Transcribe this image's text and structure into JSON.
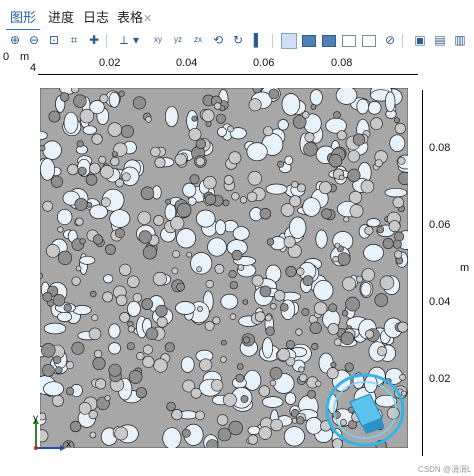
{
  "tabs": [
    {
      "label": "图形",
      "active": true
    },
    {
      "label": "进度",
      "active": false
    },
    {
      "label": "日志",
      "active": false
    },
    {
      "label": "表格",
      "active": false
    }
  ],
  "toolbar": {
    "icons": [
      "zoom-in-icon",
      "zoom-out-icon",
      "zoom-box-icon",
      "zoom-extents-icon",
      "axis-orientation-icon",
      "view-xy-icon",
      "view-yz-icon",
      "view-zx-icon",
      "rotate-icon",
      "reset-view-icon",
      "scene-light-icon",
      "render-wireframe-icon",
      "render-surface-icon",
      "render-box-icon",
      "render-transparent-icon",
      "render-edges-icon",
      "deselect-icon",
      "snapshot-icon",
      "print-icon",
      "clipboard-icon"
    ],
    "view_labels": {
      "xy": "xy",
      "yz": "yz",
      "zx": "zx"
    }
  },
  "plot": {
    "origin_label": "0",
    "unit_top": "m",
    "corner_label": "4",
    "x_ticks": [
      "0.02",
      "0.04",
      "0.06",
      "0.08"
    ],
    "y_ticks": [
      "0.08",
      "0.06",
      "0.04",
      "0.02"
    ],
    "y_unit": "m",
    "triad_y": "y",
    "triad_x": "x",
    "watermark": "CSDN @涓涓L",
    "colors": {
      "background": "#ffffff",
      "solid": "#a7a7a7",
      "pore": "#e8f2fb",
      "edge": "#1a1a1a",
      "selection": "#34b4ea"
    }
  }
}
